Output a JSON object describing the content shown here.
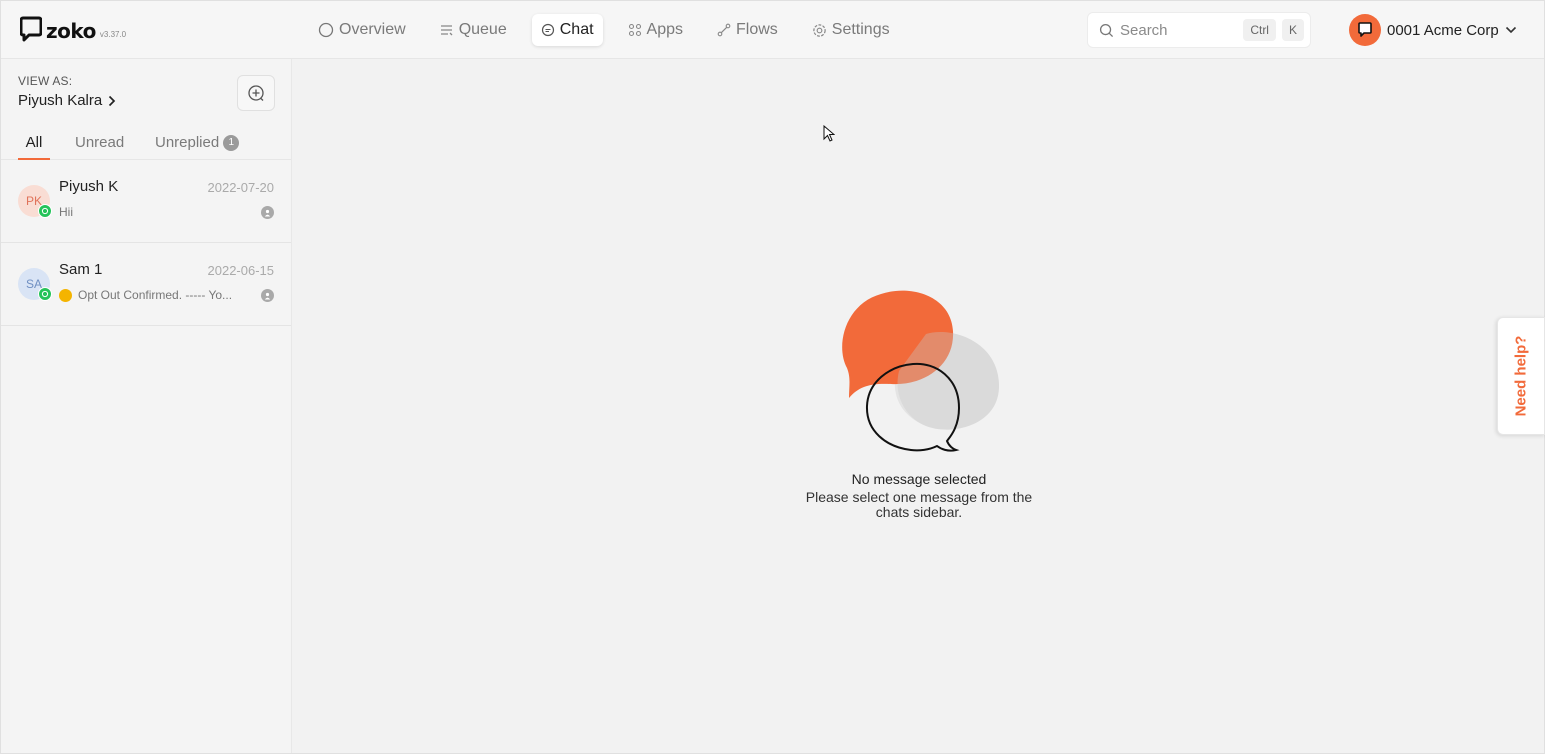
{
  "app": {
    "name": "zoko",
    "version": "v3.37.0"
  },
  "nav": {
    "items": [
      {
        "label": "Overview",
        "icon": "circle-icon",
        "active": false
      },
      {
        "label": "Queue",
        "icon": "queue-icon",
        "active": false
      },
      {
        "label": "Chat",
        "icon": "chat-icon",
        "active": true
      },
      {
        "label": "Apps",
        "icon": "apps-grid-icon",
        "active": false
      },
      {
        "label": "Flows",
        "icon": "flow-icon",
        "active": false
      },
      {
        "label": "Settings",
        "icon": "gear-icon",
        "active": false
      }
    ]
  },
  "search": {
    "placeholder": "Search",
    "shortcut_key1": "Ctrl",
    "shortcut_key2": "K"
  },
  "org": {
    "name": "0001 Acme Corp"
  },
  "sidebar": {
    "view_as_label": "VIEW AS:",
    "view_as_user": "Piyush Kalra",
    "tabs": [
      {
        "label": "All",
        "active": true
      },
      {
        "label": "Unread",
        "active": false
      },
      {
        "label": "Unreplied",
        "active": false,
        "badge": "1"
      }
    ],
    "chats": [
      {
        "initials": "PK",
        "name": "Piyush K",
        "date": "2022-07-20",
        "preview": "Hii",
        "channel": "whatsapp"
      },
      {
        "initials": "SA",
        "name": "Sam 1",
        "date": "2022-06-15",
        "preview": "Opt Out Confirmed. ----- Yo...",
        "channel": "whatsapp"
      }
    ]
  },
  "main": {
    "empty_title": "No message selected",
    "empty_subtitle": "Please select one message from the chats sidebar."
  },
  "help": {
    "label": "Need help?"
  },
  "colors": {
    "accent": "#f26a3a",
    "whatsapp": "#25c35a"
  }
}
